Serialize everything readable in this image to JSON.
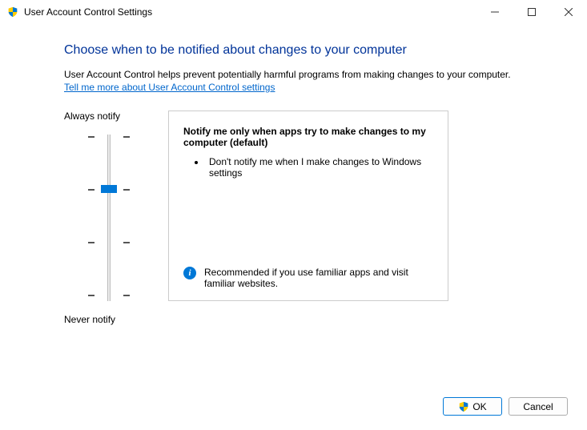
{
  "window": {
    "title": "User Account Control Settings"
  },
  "header": {
    "heading": "Choose when to be notified about changes to your computer",
    "description": "User Account Control helps prevent potentially harmful programs from making changes to your computer.",
    "link": "Tell me more about User Account Control settings"
  },
  "slider": {
    "top_label": "Always notify",
    "bottom_label": "Never notify",
    "levels": 4,
    "current_level": 2
  },
  "panel": {
    "title": "Notify me only when apps try to make changes to my computer (default)",
    "bullet1": "Don't notify me when I make changes to Windows settings",
    "recommend": "Recommended if you use familiar apps and visit familiar websites."
  },
  "buttons": {
    "ok": "OK",
    "cancel": "Cancel"
  }
}
